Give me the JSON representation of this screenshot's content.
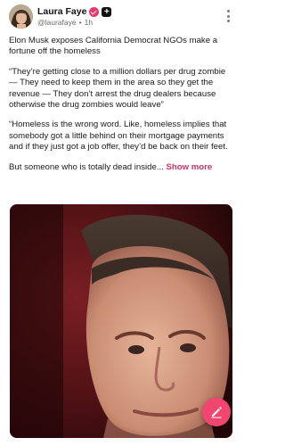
{
  "post": {
    "author": {
      "display_name": "Laura Faye",
      "handle": "@laurafaye",
      "plus_badge": "+"
    },
    "separator": "•",
    "timestamp": "1h",
    "paragraphs": [
      "Elon Musk exposes California Democrat NGOs make a fortune off the homeless",
      "“They’re getting close to a million dollars per drug zombie — They need to keep them in the area so they get the revenue — They don’t arrest the drug dealers because otherwise the drug zombies would leave”",
      "“Homeless is the wrong word. Like, homeless implies that somebody got a little behind on their mortgage payments and if they just got a job offer, they’d be back on their feet."
    ],
    "truncated_text": "But someone who is totally dead inside...",
    "show_more_label": "Show more"
  },
  "colors": {
    "accent": "#e8386d",
    "link": "#c9326a",
    "fab": "#f04670"
  },
  "icons": {
    "verified": "verified-check-icon",
    "menu": "kebab-menu-icon",
    "compose": "compose-pencil-icon"
  }
}
